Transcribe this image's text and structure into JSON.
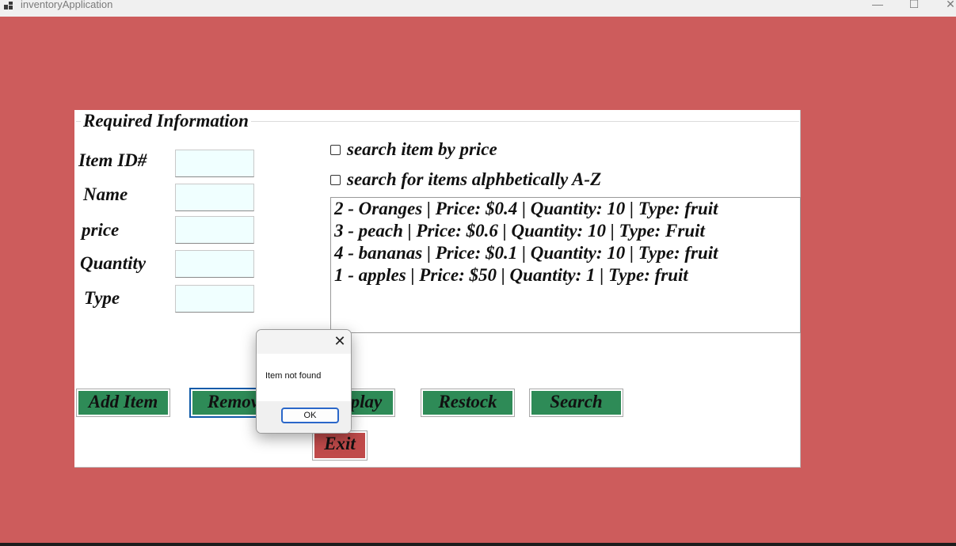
{
  "window": {
    "title": "inventoryApplication",
    "minimize_glyph": "—",
    "maximize_glyph": "☐",
    "close_glyph": "✕"
  },
  "form": {
    "group_title": "Required Information",
    "labels": {
      "item_id": "Item ID#",
      "name": "Name",
      "price": "price",
      "quantity": "Quantity",
      "type": "Type"
    },
    "fields": {
      "item_id": "",
      "name": "",
      "price": "",
      "quantity": "",
      "type": ""
    },
    "checkboxes": {
      "by_price": {
        "label": "search item by price",
        "checked": false
      },
      "alphabetical": {
        "label": "search for items alphbetically A-Z",
        "checked": false
      }
    },
    "list_items": [
      "2 - Oranges | Price: $0.4 | Quantity: 10 | Type: fruit",
      "3 - peach | Price: $0.6 | Quantity: 10 | Type: Fruit",
      "4 - bananas | Price: $0.1 | Quantity: 10 | Type: fruit",
      "1 - apples | Price: $50 | Quantity: 1 | Type: fruit"
    ],
    "buttons": {
      "add": "Add Item",
      "remove": "Remove",
      "display": "Display",
      "restock": "Restock",
      "search": "Search",
      "exit": "Exit"
    }
  },
  "dialog": {
    "message": "Item not found",
    "ok_label": "OK",
    "close_glyph": "✕"
  },
  "colors": {
    "background": "#cd5c5c",
    "button_green": "#2e8b57",
    "exit_button": "#c04a4a",
    "field_bg": "#f0ffff"
  }
}
